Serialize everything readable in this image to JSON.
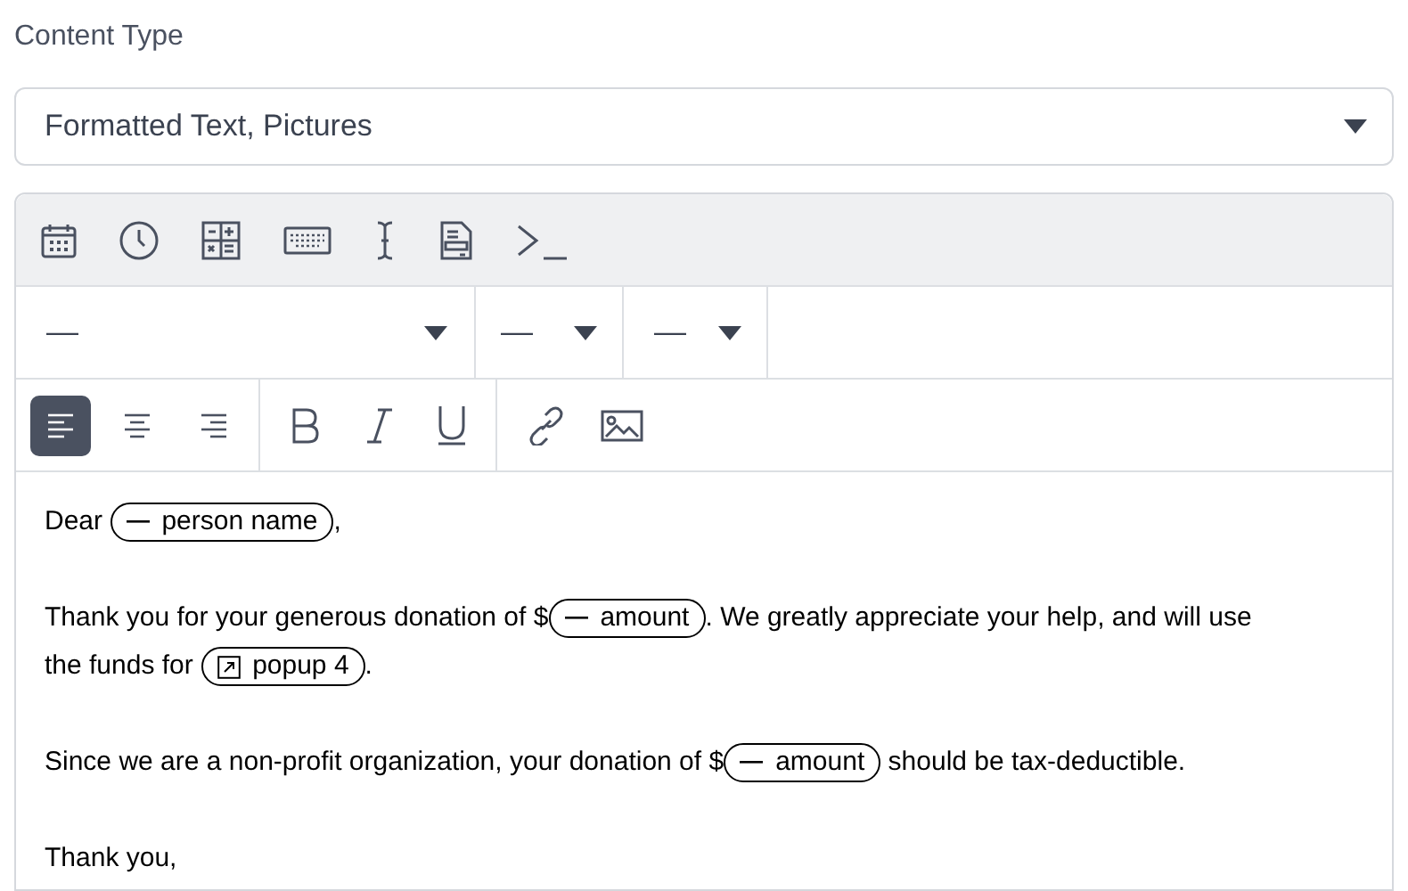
{
  "content_type": {
    "label": "Content Type",
    "value": "Formatted Text, Pictures"
  },
  "insert_toolbar": [
    {
      "kind": "date"
    },
    {
      "kind": "time"
    },
    {
      "kind": "calculation"
    },
    {
      "kind": "keyboard"
    },
    {
      "kind": "cursor"
    },
    {
      "kind": "form"
    },
    {
      "kind": "terminal"
    }
  ],
  "format_dropdowns": [
    {
      "value": "—"
    },
    {
      "value": "—"
    },
    {
      "value": "—"
    }
  ],
  "align_buttons": [
    {
      "kind": "left",
      "selected": true
    },
    {
      "kind": "center",
      "selected": false
    },
    {
      "kind": "right",
      "selected": false
    }
  ],
  "style_buttons": [
    {
      "kind": "bold"
    },
    {
      "kind": "italic"
    },
    {
      "kind": "underline"
    }
  ],
  "insert_buttons": [
    {
      "kind": "link"
    },
    {
      "kind": "image"
    }
  ],
  "paragraphs": [
    [
      {
        "kind": "text",
        "text": "Dear "
      },
      {
        "kind": "field",
        "text": "person name"
      },
      {
        "kind": "text",
        "text": ","
      }
    ],
    [
      {
        "kind": "text",
        "text": "Thank you for your generous donation of $"
      },
      {
        "kind": "field",
        "text": "amount"
      },
      {
        "kind": "text",
        "text": ". We greatly appreciate your help, and will use the funds for "
      },
      {
        "kind": "popup",
        "text": "popup 4"
      },
      {
        "kind": "text",
        "text": "."
      }
    ],
    [
      {
        "kind": "text",
        "text": "Since we are a non-profit organization, your donation of $"
      },
      {
        "kind": "field",
        "text": "amount"
      },
      {
        "kind": "text",
        "text": " should be tax-deductible."
      }
    ],
    [
      {
        "kind": "text",
        "text": "Thank you,"
      }
    ]
  ]
}
